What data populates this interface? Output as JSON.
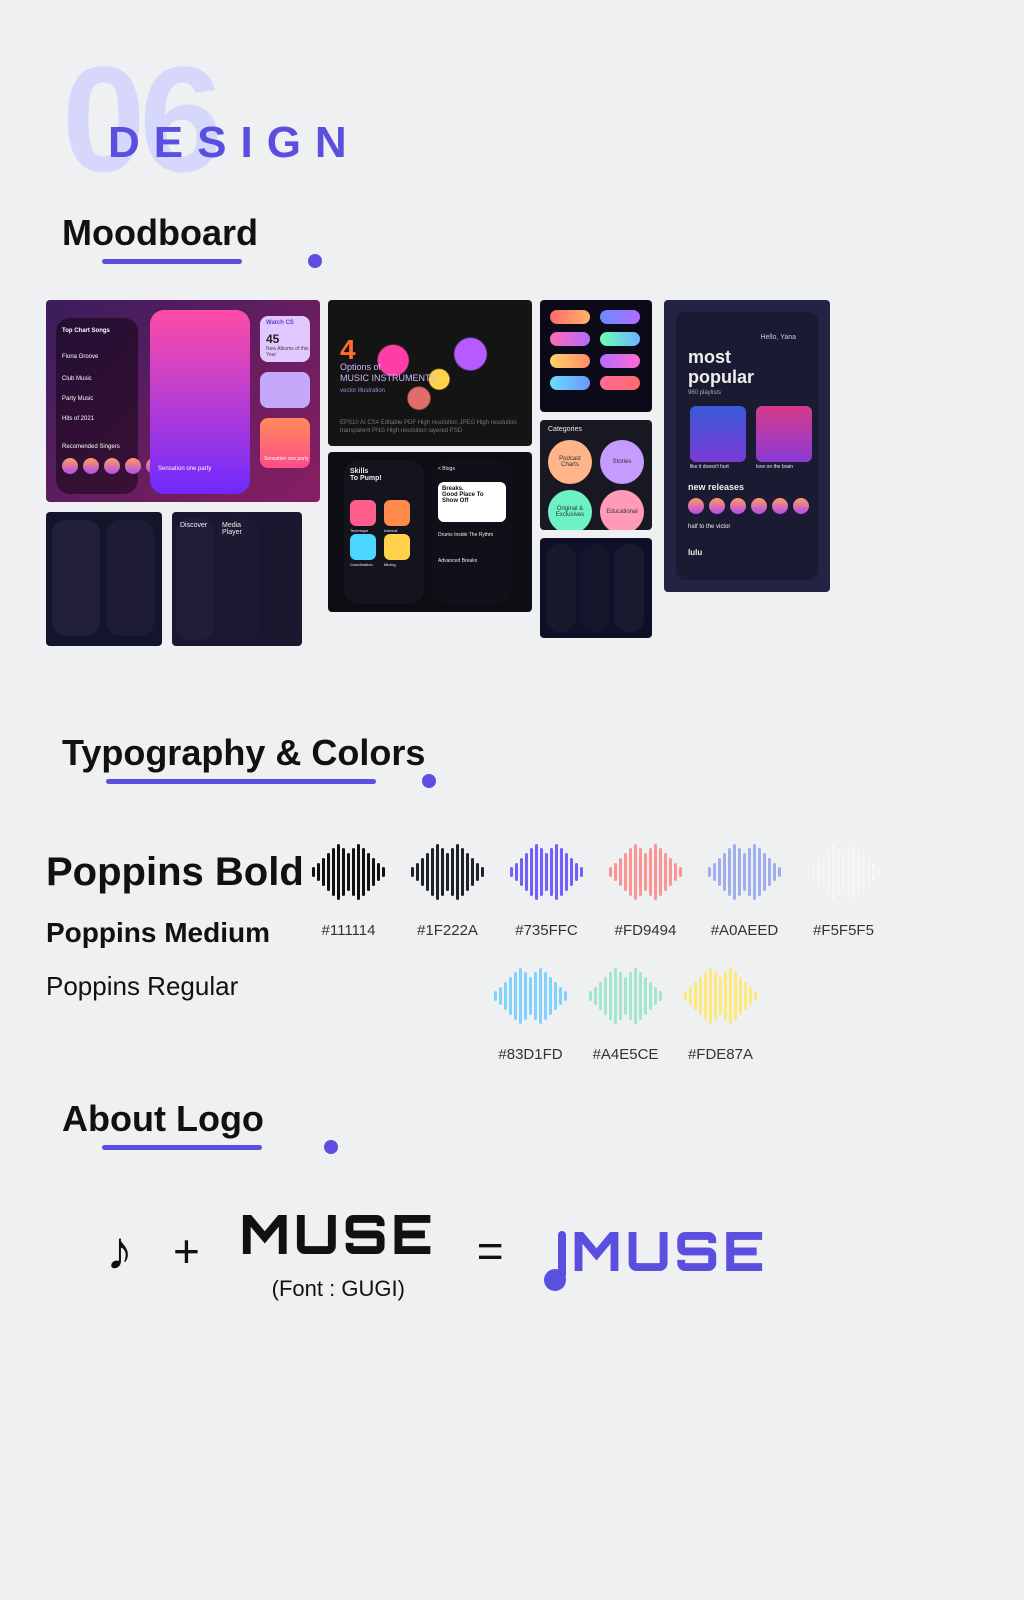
{
  "header": {
    "number": "06",
    "title": "DESIGN"
  },
  "sections": {
    "moodboard": "Moodboard",
    "typography": "Typography & Colors",
    "logo": "About Logo"
  },
  "moodboard": {
    "card1": {
      "heading": "Top Chart Songs",
      "row1": "Fiona Groove",
      "row2": "Club Music",
      "row3": "Party Music",
      "row4": "Hits of 2021",
      "rec": "Recomended Singers",
      "now": "Sensation one party",
      "sideTitle": "Watch CS",
      "sideNum": "45",
      "sideSub": "New Albums of this Year"
    },
    "card3": {
      "a": "Discover",
      "b": "Media Player"
    },
    "card4": {
      "num": "4",
      "line1": "Options of",
      "line2": "MUSIC INSTRUMENTS",
      "sub": "vector illustration",
      "meta": "EPS10\nAI CS4\nEditable PDF\nHigh resolution JPEG\nHigh resolution transparent PNG\nHigh resolution layered PSD"
    },
    "card5": {
      "title": "Skills\nTo Pump!",
      "tiles": [
        "Technique",
        "Internal",
        "Coordination",
        "Mixing"
      ],
      "panel_title": "Breaks.\nGood Place To\nShow Off",
      "panel_items": [
        "Drums Inside The Rythm",
        "Advanced Breaks"
      ],
      "top": "< Blogs"
    },
    "card7": {
      "title": "Categories",
      "cats": [
        "Podcast Charts",
        "Stories",
        "Original & Exclusives",
        "Educational"
      ]
    },
    "card9": {
      "hello": "Hello, Yana",
      "h1": "most\npopular",
      "sub1": "960 playlists",
      "tile1": "like it doesn't hurt",
      "tile2": "love on the brain",
      "h2": "new releases",
      "track": "half to the victor",
      "artist": "lulu"
    }
  },
  "typography": {
    "l1": "Poppins Bold",
    "l2": "Poppins Medium",
    "l3": "Poppins Regular"
  },
  "colors_row1": [
    {
      "hex": "#111114"
    },
    {
      "hex": "#1F222A"
    },
    {
      "hex": "#735FFC"
    },
    {
      "hex": "#FD9494"
    },
    {
      "hex": "#A0AEED"
    },
    {
      "hex": "#F5F5F5"
    }
  ],
  "colors_row2": [
    {
      "hex": "#83D1FD"
    },
    {
      "hex": "#A4E5CE"
    },
    {
      "hex": "#FDE87A"
    }
  ],
  "logo": {
    "plus": "+",
    "word": "MUSE",
    "font_note": "(Font : GUGI)",
    "eq": "=",
    "final": "MUSE"
  }
}
